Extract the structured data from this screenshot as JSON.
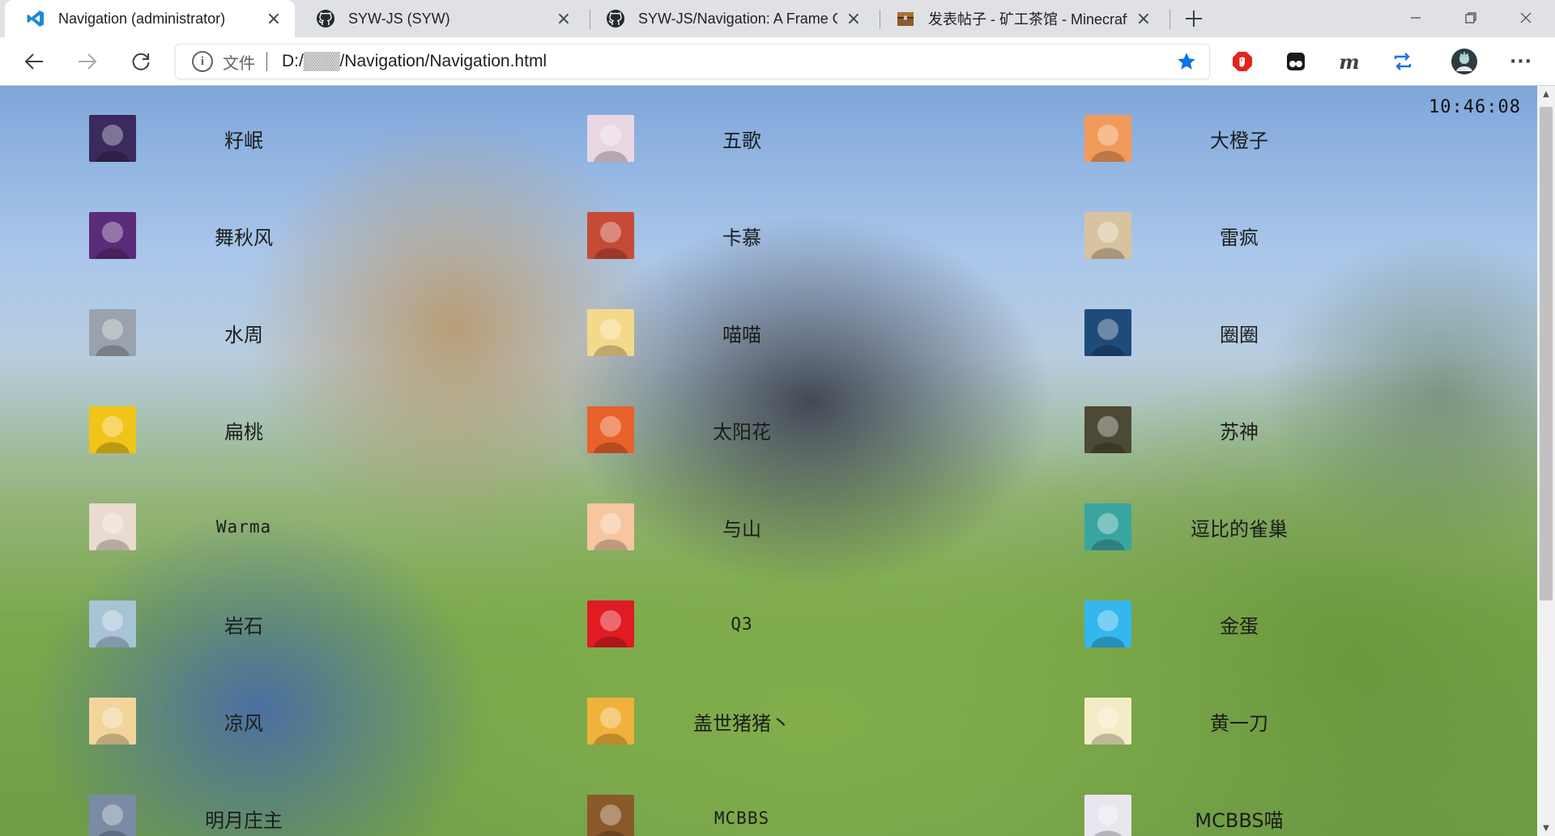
{
  "tabs": [
    {
      "title": "Navigation (administrator)",
      "icon": "vscode-icon",
      "active": true
    },
    {
      "title": "SYW-JS (SYW)",
      "icon": "github-icon",
      "active": false
    },
    {
      "title": "SYW-JS/Navigation: A Frame Of",
      "icon": "github-icon",
      "active": false
    },
    {
      "title": "发表帖子 - 矿工茶馆 - Minecraft(",
      "icon": "chest-icon",
      "active": false
    }
  ],
  "window_controls": {
    "minimize": "—",
    "restore": "❐",
    "close": "✕"
  },
  "toolbar": {
    "address_label": "文件",
    "address_url": "D:/▒▒▒/Navigation/Navigation.html",
    "extensions": [
      "adblock-icon",
      "tampermonkey-icon",
      "m-extension-icon",
      "sync-extension-icon",
      "profile-avatar-icon",
      "more-menu-icon"
    ],
    "ext_m_label": "m",
    "more_label": "···"
  },
  "clock": "10:46:08",
  "nav_items": [
    [
      {
        "name": "籽岷",
        "avatar": "#3a2a5e"
      },
      {
        "name": "五歌",
        "avatar": "#e8d7e3"
      },
      {
        "name": "大橙子",
        "avatar": "#f29a5a"
      }
    ],
    [
      {
        "name": "舞秋风",
        "avatar": "#5b2c7a"
      },
      {
        "name": "卡慕",
        "avatar": "#c64a36"
      },
      {
        "name": "雷疯",
        "avatar": "#d9c2a0"
      }
    ],
    [
      {
        "name": "水周",
        "avatar": "#9aa3ad"
      },
      {
        "name": "喵喵",
        "avatar": "#f4d98a"
      },
      {
        "name": "圈圈",
        "avatar": "#1e4c7a"
      }
    ],
    [
      {
        "name": "扁桃",
        "avatar": "#f0c419"
      },
      {
        "name": "太阳花",
        "avatar": "#e8622b"
      },
      {
        "name": "苏神",
        "avatar": "#4c4a36"
      }
    ],
    [
      {
        "name": "Warma",
        "avatar": "#eadbd0"
      },
      {
        "name": "与山",
        "avatar": "#f6c6a0"
      },
      {
        "name": "逗比的雀巢",
        "avatar": "#3aa5a0"
      }
    ],
    [
      {
        "name": "岩石",
        "avatar": "#a7c3d6"
      },
      {
        "name": "Q3",
        "avatar": "#e01b22"
      },
      {
        "name": "金蛋",
        "avatar": "#33b7ee"
      }
    ],
    [
      {
        "name": "凉风",
        "avatar": "#f2d59b"
      },
      {
        "name": "盖世猪猪丶",
        "avatar": "#f0b23a"
      },
      {
        "name": "黄一刀",
        "avatar": "#f4ecc6"
      }
    ],
    [
      {
        "name": "明月庄主",
        "avatar": "#7a8ba6"
      },
      {
        "name": "MCBBS",
        "avatar": "#8a5a2b"
      },
      {
        "name": "MCBBS喵",
        "avatar": "#e9e6ef"
      }
    ]
  ],
  "colors": {
    "accent": "#1a73e8",
    "star": "#0a74e5",
    "adblock": "#e1251b",
    "text": "#1c1c1c"
  }
}
